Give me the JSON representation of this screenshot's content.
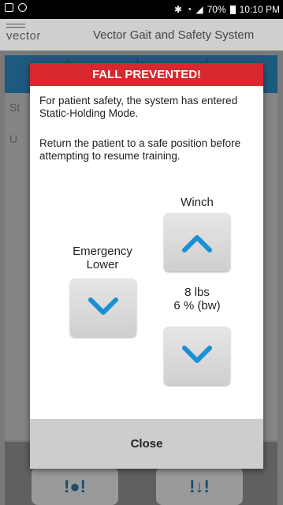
{
  "status_bar": {
    "battery": "70%",
    "time": "10:10 PM",
    "icons": [
      "gallery-icon",
      "notification-icon",
      "bluetooth-icon",
      "wifi-icon",
      "signal-icon",
      "battery-icon"
    ]
  },
  "app": {
    "logo": "vector",
    "title": "Vector Gait and Safety System"
  },
  "background": {
    "text1": "St",
    "text2": "U"
  },
  "dialog": {
    "title": "FALL PREVENTED!",
    "message1": "For patient safety, the system has entered Static-Holding Mode.",
    "message2": "Return the patient to a safe position before attempting to resume training.",
    "winch_label": "Winch",
    "emergency_label_line1": "Emergency",
    "emergency_label_line2": "Lower",
    "weight_lbs": "8 lbs",
    "weight_pct": "6 % (bw)",
    "close_label": "Close",
    "accent_color": "#d7282f",
    "arrow_color": "#1a8fd3"
  }
}
